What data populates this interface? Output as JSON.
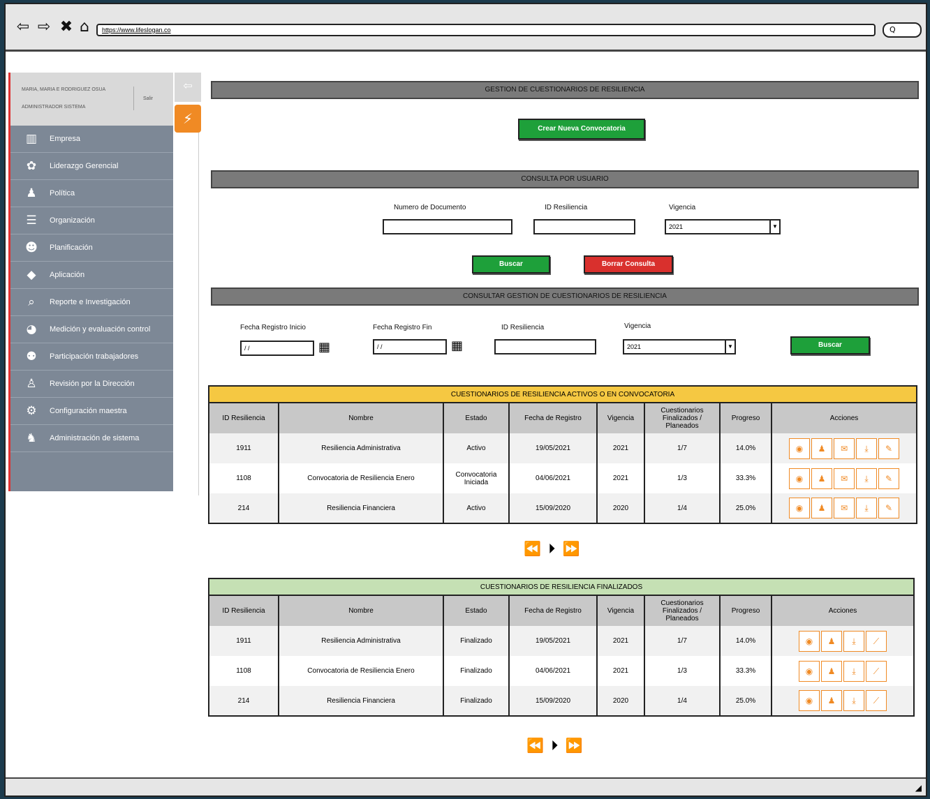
{
  "browser": {
    "back": "⇦",
    "forward": "⇨",
    "close": "✖",
    "home": "⌂",
    "url": "https://www.lifeslogan.co",
    "search": "Q"
  },
  "user": {
    "name": "MARIA, MARIA E RODRIGUEZ OSUA",
    "role": "ADMINISTRADOR SISTEMA",
    "logout": "Salir"
  },
  "sidebar": {
    "collapse": "⇦",
    "quick": "⚡",
    "items": [
      {
        "icon": "building-icon",
        "glyph": "▥",
        "label": "Empresa"
      },
      {
        "icon": "leadership-icon",
        "glyph": "✿",
        "label": "Liderazgo Gerencial"
      },
      {
        "icon": "policy-icon",
        "glyph": "♟",
        "label": "Política"
      },
      {
        "icon": "list-icon",
        "glyph": "☰",
        "label": "Organización"
      },
      {
        "icon": "planning-icon",
        "glyph": "☻",
        "label": "Planificación"
      },
      {
        "icon": "tag-icon",
        "glyph": "◆",
        "label": "Aplicación"
      },
      {
        "icon": "search-icon",
        "glyph": "⌕",
        "label": "Reporte e Investigación"
      },
      {
        "icon": "pie-icon",
        "glyph": "◕",
        "label": "Medición y evaluación control"
      },
      {
        "icon": "people-icon",
        "glyph": "⚉",
        "label": "Participación trabajadores"
      },
      {
        "icon": "person-icon",
        "glyph": "♙",
        "label": "Revisión por la Dirección"
      },
      {
        "icon": "config-icon",
        "glyph": "⚙",
        "label": "Configuración maestra"
      },
      {
        "icon": "admin-icon",
        "glyph": "♞",
        "label": "Administración de sistema"
      }
    ]
  },
  "main": {
    "title": "GESTION DE CUESTIONARIOS DE RESILIENCIA",
    "create_button": "Crear Nueva Convocatoria",
    "user_query": {
      "title": "CONSULTA POR USUARIO",
      "doc_label": "Numero de Documento",
      "id_label": "ID Resiliencia",
      "vig_label": "Vigencia",
      "vig_value": "2021",
      "search": "Buscar",
      "clear": "Borrar Consulta"
    },
    "mgmt_query": {
      "title": "CONSULTAR GESTION DE CUESTIONARIOS DE RESILIENCIA",
      "start_label": "Fecha Registro Inicio",
      "start_value": "/ /",
      "end_label": "Fecha Registro Fin",
      "end_value": "/ /",
      "id_label": "ID Resiliencia",
      "vig_label": "Vigencia",
      "vig_value": "2021",
      "search": "Buscar"
    }
  },
  "active_table": {
    "caption": "CUESTIONARIOS DE RESILIENCIA ACTIVOS O EN CONVOCATORIA",
    "headers": [
      "ID Resiliencia",
      "Nombre",
      "Estado",
      "Fecha de Registro",
      "Vigencia",
      "Cuestionarios Finalizados / Planeados",
      "Progreso",
      "Acciones"
    ],
    "rows": [
      {
        "id": "1911",
        "name": "Resiliencia Administrativa",
        "state": "Activo",
        "date": "19/05/2021",
        "vig": "2021",
        "count": "1/7",
        "progress": "14.0%"
      },
      {
        "id": "1108",
        "name": "Convocatoria de Resiliencia Enero",
        "state": "Convocatoria Iniciada",
        "date": "04/06/2021",
        "vig": "2021",
        "count": "1/3",
        "progress": "33.3%"
      },
      {
        "id": "214",
        "name": "Resiliencia Financiera",
        "state": "Activo",
        "date": "15/09/2020",
        "vig": "2020",
        "count": "1/4",
        "progress": "25.0%"
      }
    ],
    "pager": "⏪ ⏵ ⏩"
  },
  "final_table": {
    "caption": "CUESTIONARIOS DE RESILIENCIA FINALIZADOS",
    "headers": [
      "ID Resiliencia",
      "Nombre",
      "Estado",
      "Fecha de Registro",
      "Vigencia",
      "Cuestionarios Finalizados / Planeados",
      "Progreso",
      "Acciones"
    ],
    "rows": [
      {
        "id": "1911",
        "name": "Resiliencia Administrativa",
        "state": "Finalizado",
        "date": "19/05/2021",
        "vig": "2021",
        "count": "1/7",
        "progress": "14.0%"
      },
      {
        "id": "1108",
        "name": "Convocatoria de Resiliencia Enero",
        "state": "Finalizado",
        "date": "04/06/2021",
        "vig": "2021",
        "count": "1/3",
        "progress": "33.3%"
      },
      {
        "id": "214",
        "name": "Resiliencia Financiera",
        "state": "Finalizado",
        "date": "15/09/2020",
        "vig": "2020",
        "count": "1/4",
        "progress": "25.0%"
      }
    ],
    "pager": "⏪ ⏵ ⏩"
  },
  "colors": {
    "accent": "#f08a24",
    "green": "#1ea03a",
    "red": "#d9302d",
    "sidebar": "#7d8896",
    "active_caption": "#f5c842",
    "final_caption": "#c5e0b4"
  }
}
